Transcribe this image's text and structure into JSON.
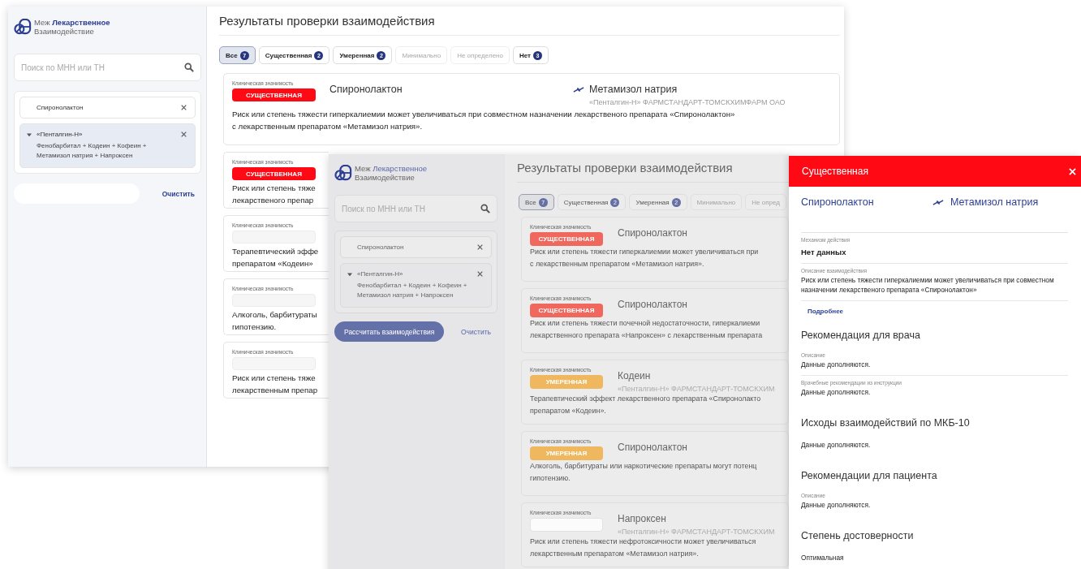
{
  "back_window": {
    "dimmed": false,
    "logo": {
      "prefix": "Меж",
      "brand": "Лекарственное",
      "subtitle": "Взаимодействие"
    },
    "search": {
      "placeholder": "Поиск по МНН или ТН"
    },
    "selected_drugs": [
      {
        "name": "Спиронолактон"
      },
      {
        "name": "«Пенталгин-Н»",
        "expanded": true,
        "composition": "Фенобарбитал + Кодеин + Кофеин + Метамизол натрия + Напроксен"
      }
    ],
    "clear_link": "Очистить",
    "results": {
      "title": "Результаты проверки взаимодействия",
      "filters": [
        {
          "label": "Все",
          "count": "7",
          "selected": true,
          "disabled": false
        },
        {
          "label": "Существенная",
          "count": "2",
          "selected": false,
          "disabled": false
        },
        {
          "label": "Умеренная",
          "count": "2",
          "selected": false,
          "disabled": false
        },
        {
          "label": "Минимально",
          "selected": false,
          "disabled": true
        },
        {
          "label": "Не определено",
          "selected": false,
          "disabled": true
        },
        {
          "label": "Нет",
          "count": "3",
          "selected": false,
          "disabled": false
        }
      ],
      "cards": [
        {
          "label": "Клиническая значимость",
          "kind": "significant",
          "badge": "СУЩЕСТВЕННАЯ",
          "drugs": [
            {
              "name": "Спиронолактон"
            },
            {
              "name": "Метамизол натрия",
              "source": "«Пенталгин-Н» ФАРМСТАНДАРТ-ТОМСКХИМФАРМ ОАО"
            }
          ],
          "text_lines": [
            "Риск или степень тяжести гиперкалиемии может увеличиваться при совместном назначении лекарственого препарата «Спиронолактон»",
            "с лекарственным препаратом «Метамизол натрия»."
          ]
        },
        {
          "label": "Клиническая значимость",
          "kind": "significant",
          "badge": "СУЩЕСТВЕННАЯ",
          "text_lines": [
            "Риск или степень тяже",
            "лекарственого препар"
          ]
        },
        {
          "label": "Клиническая значимость",
          "kind": "none",
          "text_lines": [
            "Терапевтический эффе",
            "препаратом «Кодеин»"
          ]
        },
        {
          "label": "Клиническая значимость",
          "kind": "none",
          "text_lines": [
            "Алкоголь, барбитураты",
            "гипотензию."
          ]
        },
        {
          "label": "Клиническая значимость",
          "kind": "none",
          "text_lines": [
            "Риск или степень тяже",
            "лекарственным препар"
          ]
        }
      ]
    }
  },
  "front_window": {
    "dimmed": true,
    "logo": {
      "prefix": "Меж",
      "brand": "Лекарственное",
      "subtitle": "Взаимодействие"
    },
    "search": {
      "placeholder": "Поиск по МНН или ТН"
    },
    "selected_drugs": [
      {
        "name": "Спиронолактон"
      },
      {
        "name": "«Пенталгин-Н»",
        "expanded": true,
        "composition": "Фенобарбитал + Кодеин + Кофеин + Метамизол натрия + Напроксен"
      }
    ],
    "calculate_button": "Рассчитать взаимодействия",
    "clear_link": "Очистить",
    "results": {
      "title": "Результаты проверки взаимодействия",
      "filters": [
        {
          "label": "Все",
          "count": "7",
          "selected": true,
          "disabled": false
        },
        {
          "label": "Существенная",
          "count": "2",
          "selected": false,
          "disabled": false
        },
        {
          "label": "Умеренная",
          "count": "2",
          "selected": false,
          "disabled": false
        },
        {
          "label": "Минимально",
          "selected": false,
          "disabled": true
        },
        {
          "label": "Не опред",
          "selected": false,
          "disabled": true
        }
      ],
      "cards": [
        {
          "label": "Клиническая значимость",
          "kind": "significant",
          "badge": "СУЩЕСТВЕННАЯ",
          "drugs": [
            {
              "name": "Спиронолактон"
            }
          ],
          "text_lines": [
            "Риск или степень тяжести гиперкалиемии может увеличиваться при",
            "с лекарственным препаратом «Метамизол натрия»."
          ]
        },
        {
          "label": "Клиническая значимость",
          "kind": "significant",
          "badge": "СУЩЕСТВЕННАЯ",
          "drugs": [
            {
              "name": "Спиронолактон"
            }
          ],
          "text_lines": [
            "Риск или степень тяжести почечной недостаточности, гиперкалиеми",
            "лекарственного препарата «Напроксен» с лекарственным препарата"
          ]
        },
        {
          "label": "Клиническая значимость",
          "kind": "moderate",
          "badge": "УМЕРЕННАЯ",
          "drugs": [
            {
              "name": "Кодеин",
              "source": "«Пенталгин-Н» ФАРМСТАНДАРТ-ТОМСКХИМ"
            }
          ],
          "text_lines": [
            "Терапевтический эффект лекарственного препарата «Спиронолакто",
            "препаратом «Кодеин»."
          ]
        },
        {
          "label": "Клиническая значимость",
          "kind": "moderate",
          "badge": "УМЕРЕННАЯ",
          "drugs": [
            {
              "name": "Спиронолактон"
            }
          ],
          "text_lines": [
            "Алкоголь, барбитураты или наркотические препараты могут потенц",
            "гипотензию."
          ]
        },
        {
          "label": "Клиническая значимость",
          "kind": "none",
          "drugs": [
            {
              "name": "Напроксен",
              "source": "«Пенталгин-Н» ФАРМСТАНДАРТ-ТОМСКХИМ"
            }
          ],
          "text_lines": [
            "Риск или степень тяжести нефротоксичности может увеличиваться",
            "лекарственным препаратом «Метамизол натрия»."
          ]
        }
      ]
    }
  },
  "details_panel": {
    "kind": "significant",
    "title": "Существенная",
    "drugs": [
      {
        "name": "Спиронолактон"
      },
      {
        "name": "Метамизол натрия"
      }
    ],
    "sections": [
      {
        "fields": [
          {
            "label": "Механизм действия",
            "value": "Нет данных",
            "emphasis": true
          },
          {
            "label": "Описание взаимодействия",
            "value": "Риск или степень тяжести гиперкалиемии может увеличиваться при совместном назначении лекарственого препарата «Спиронолактон»",
            "emphasis": false
          }
        ],
        "link": "Подробнее"
      },
      {
        "title": "Рекомендация для врача",
        "fields": [
          {
            "label": "Описание",
            "value": "Данные дополняются.",
            "emphasis": false
          },
          {
            "label": "Врачебные рекомендации из инструкции",
            "value": "Данные дополняются.",
            "emphasis": false
          }
        ]
      },
      {
        "title": "Исходы взаимодействий по МКБ-10",
        "fields": [
          {
            "value": "Данные дополняются.",
            "emphasis": false
          }
        ]
      },
      {
        "title": "Рекомендации для пациента",
        "fields": [
          {
            "label": "Описание",
            "value": "Данные дополняются.",
            "emphasis": false
          }
        ]
      },
      {
        "title": "Степень достоверности",
        "fields": [
          {
            "value": "Оптимальная",
            "emphasis": false
          }
        ]
      }
    ]
  }
}
